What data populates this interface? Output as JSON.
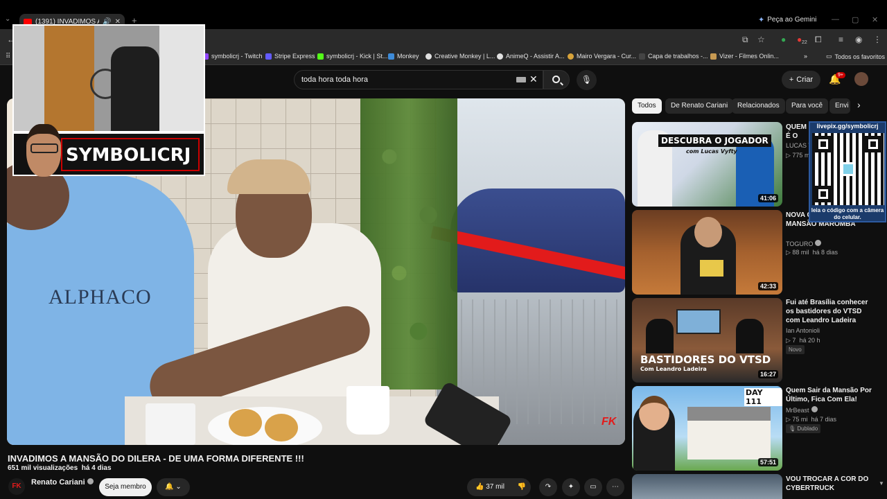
{
  "browser": {
    "tab_title": "(1391) INVADIMOS A MANSÃO",
    "gemini_label": "Peça ao Gemini",
    "bookmarks": [
      {
        "label": "symbolicrj - Twitch",
        "color": "#9146ff"
      },
      {
        "label": "Stripe Express",
        "color": "#635bff"
      },
      {
        "label": "symbolicrj - Kick | St...",
        "color": "#53fc18"
      },
      {
        "label": "Monkey",
        "color": "#3d8bd9"
      },
      {
        "label": "Creative Monkey | L...",
        "color": "#e0e0e0"
      },
      {
        "label": "AnimeQ - Assistir A...",
        "color": "#e0e0e0"
      },
      {
        "label": "Mairo Vergara - Cur...",
        "color": "#d8a33a"
      },
      {
        "label": "Capa de trabalhos -...",
        "color": "#444444"
      },
      {
        "label": "Vizer - Filmes Onlin...",
        "color": "#c79a52"
      },
      {
        "label": "Todos os favoritos",
        "color": "#e0e0e0"
      }
    ],
    "extension_badge": "22"
  },
  "youtube_header": {
    "search_value": "toda hora toda hora",
    "create_label": "Criar",
    "notifications_badge": "9+"
  },
  "stream_overlay": {
    "streamer_name": "SYMBOLICRJ",
    "qr_url": "livepix.gg/symbolicrj",
    "qr_hint": "leia o código com a câmera do celular."
  },
  "video": {
    "title": "INVADIMOS A MANSÃO DO DILERA - DE UMA FORMA DIFERENTE !!!",
    "views": "651 mil visualizações",
    "age": "há 4 dias",
    "channel": "Renato Cariani",
    "channel_logo": "FK",
    "join_label": "Seja membro",
    "likes": "37 mil",
    "shirt_text": "ALPHACO",
    "watermark": "FK"
  },
  "filters": [
    "Todos",
    "De Renato Cariani",
    "Relacionados",
    "Para você",
    "Envi"
  ],
  "recommendations": [
    {
      "title": "QUEM É O JOGADOR PROFIS...",
      "channel": "LUCAS T...",
      "stats": "775 m...",
      "duration": "41:06",
      "thumb_text": "DESCUBRA O JOGADOR",
      "thumb_sub": "com Lucas Vyfty"
    },
    {
      "title": "NOVA C... DE OVO DA MANSÃO MAROMBA",
      "channel": "TOGURO",
      "views": "88 mil",
      "age": "há 8 dias",
      "duration": "42:33"
    },
    {
      "title": "Fui até Brasília conhecer os bastidores do VTSD com Leandro Ladeira",
      "channel": "Ian Antonioli",
      "views": "7",
      "age": "há 20 h",
      "badge": "Novo",
      "duration": "16:27",
      "thumb_text": "BASTIDORES DO VTSD",
      "thumb_sub": "Com Leandro Ladeira"
    },
    {
      "title": "Quem Sair da Mansão Por Último, Fica Com Ela!",
      "channel": "MrBeast",
      "views": "75 mi",
      "age": "há 7 dias",
      "badge": "Dublado",
      "duration": "57:51",
      "thumb_text": "DAY 111"
    },
    {
      "title": "VOU TROCAR A COR DO CYBERTRUCK"
    }
  ]
}
